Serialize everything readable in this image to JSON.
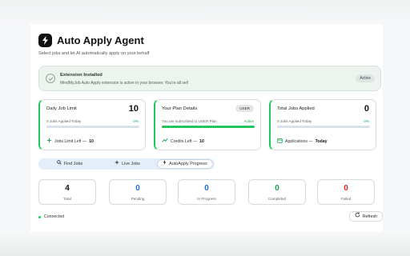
{
  "header": {
    "title": "Auto Apply Agent",
    "subtitle": "Select jobs and let AI automatically apply on your behalf"
  },
  "alert": {
    "title": "Extension Installed",
    "text": "MindMyJob Auto Apply extension is active in your browser. You're all set!",
    "badge": "Active"
  },
  "cards": {
    "daily": {
      "label": "Daily Job Limit",
      "value": "10",
      "sub": "0 Jobs Applied Today",
      "pct": "0%",
      "progress": 0,
      "foot_label": "Jobs Limit Left —",
      "foot_value": "10"
    },
    "plan": {
      "label": "Your Plan Details",
      "badge": "USER",
      "sub": "You are subscribed to USER Plan",
      "status": "Active",
      "foot_label": "Credits Left —",
      "foot_value": "10"
    },
    "total": {
      "label": "Total Jobs Applied",
      "value": "0",
      "sub": "0 Jobs Applied Today",
      "pct": "0%",
      "progress": 0,
      "foot_label": "Applications —",
      "foot_value": "Today"
    }
  },
  "tabs": [
    {
      "label": "Find Jobs",
      "icon": "search-icon"
    },
    {
      "label": "Live Jobs",
      "icon": "sparkle-icon"
    },
    {
      "label": "AutoApply Progress",
      "icon": "lightning-icon",
      "active": true
    }
  ],
  "stats": [
    {
      "value": "4",
      "label": "Total",
      "color": "#111111"
    },
    {
      "value": "0",
      "label": "Pending",
      "color": "#1d6fd8"
    },
    {
      "value": "0",
      "label": "In Progress",
      "color": "#1d6fd8"
    },
    {
      "value": "0",
      "label": "Completed",
      "color": "#16a34a"
    },
    {
      "value": "0",
      "label": "Failed",
      "color": "#dc2626"
    }
  ],
  "footer": {
    "status": "Connected",
    "refresh": "Refresh"
  },
  "colors": {
    "accent_green": "#22c55e",
    "status_blue": "#1d6fd8",
    "status_red": "#dc2626"
  }
}
